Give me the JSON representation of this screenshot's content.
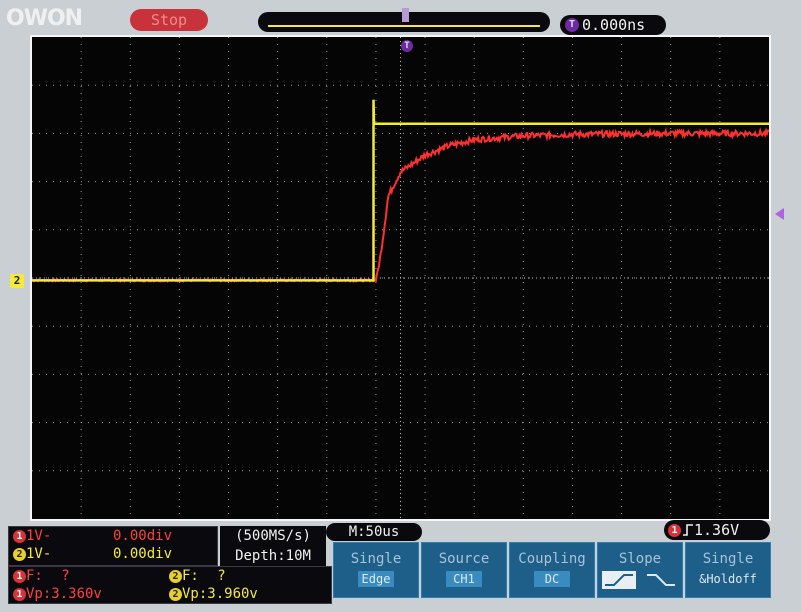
{
  "brand": "OWON",
  "run_state": "Stop",
  "timebase_delay": "0.000ns",
  "trigger_tag": "T",
  "ch2_tag": "2",
  "channels": [
    {
      "id": "1",
      "scale": "1V-",
      "pos": "0.00div",
      "freq_label": "F:",
      "freq": "?",
      "vp": "Vp:3.360v",
      "color": "#ff3030"
    },
    {
      "id": "2",
      "scale": "1V-",
      "pos": "0.00div",
      "freq_label": "F:",
      "freq": "?",
      "vp": "Vp:3.960v",
      "color": "#f3ea3c"
    }
  ],
  "acquisition": {
    "rate": "(500MS/s)",
    "depth": "Depth:10M"
  },
  "main_timebase": "M:50us",
  "trigger": {
    "channel": "1",
    "level": "1.36V"
  },
  "menu": [
    {
      "title": "Single",
      "sub": "Edge"
    },
    {
      "title": "Source",
      "sub": "CH1"
    },
    {
      "title": "Coupling",
      "sub": "DC"
    },
    {
      "title": "Slope",
      "sub": ""
    },
    {
      "title": "Single",
      "sub": "&Holdoff"
    }
  ],
  "chart_data": {
    "type": "line",
    "grid": "10x15 divisions, dotted",
    "series": [
      {
        "id": "1",
        "color": "#ff3030",
        "x_div": [
          0,
          7.0,
          7.1,
          7.25,
          7.5,
          8,
          8.5,
          9,
          10,
          11,
          12,
          13,
          14,
          15
        ],
        "y_div": [
          -0.05,
          -0.05,
          0.5,
          1.7,
          2.2,
          2.55,
          2.75,
          2.87,
          2.95,
          2.98,
          2.99,
          3.0,
          3.0,
          3.0
        ]
      },
      {
        "id": "2",
        "color": "#f3ea3c",
        "x_div": [
          0,
          6.95,
          6.95,
          6.96,
          15
        ],
        "y_div": [
          -0.05,
          -0.05,
          3.7,
          3.2,
          3.2
        ]
      }
    ]
  }
}
